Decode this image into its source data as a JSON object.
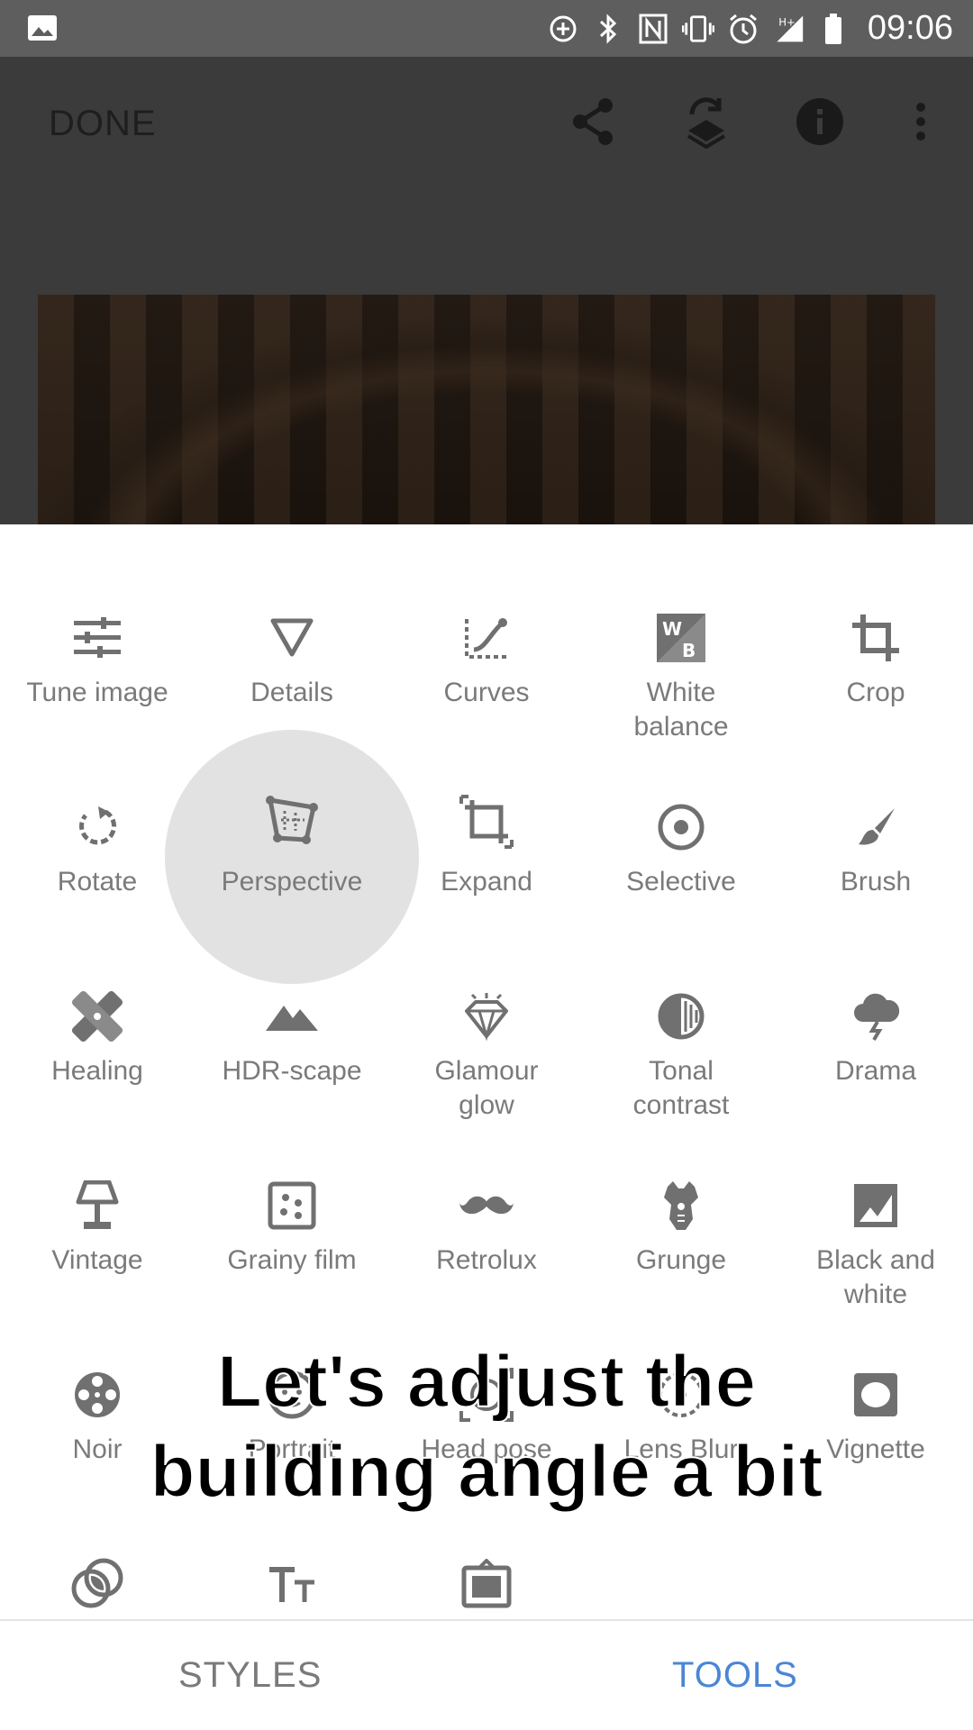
{
  "status_bar": {
    "time": "09:06",
    "icons": [
      "image-icon",
      "data-saver-icon",
      "bluetooth-icon",
      "nfc-icon",
      "vibrate-icon",
      "alarm-icon",
      "signal-hplus-icon",
      "battery-icon"
    ]
  },
  "top_bar": {
    "done_label": "DONE",
    "icons": [
      "share-icon",
      "layers-undo-icon",
      "info-icon",
      "more-vert-icon"
    ]
  },
  "tools": [
    {
      "label": "Tune image",
      "icon": "tune-icon"
    },
    {
      "label": "Details",
      "icon": "details-triangle-icon"
    },
    {
      "label": "Curves",
      "icon": "curves-icon"
    },
    {
      "label": "White\nbalance",
      "icon": "white-balance-icon"
    },
    {
      "label": "Crop",
      "icon": "crop-icon"
    },
    {
      "label": "Rotate",
      "icon": "rotate-icon"
    },
    {
      "label": "Perspective",
      "icon": "perspective-icon"
    },
    {
      "label": "Expand",
      "icon": "expand-icon"
    },
    {
      "label": "Selective",
      "icon": "selective-icon"
    },
    {
      "label": "Brush",
      "icon": "brush-icon"
    },
    {
      "label": "Healing",
      "icon": "healing-icon"
    },
    {
      "label": "HDR-scape",
      "icon": "mountains-icon"
    },
    {
      "label": "Glamour\nglow",
      "icon": "diamond-icon"
    },
    {
      "label": "Tonal\ncontrast",
      "icon": "tonal-contrast-icon"
    },
    {
      "label": "Drama",
      "icon": "storm-cloud-icon"
    },
    {
      "label": "Vintage",
      "icon": "lamp-icon"
    },
    {
      "label": "Grainy film",
      "icon": "grainy-film-icon"
    },
    {
      "label": "Retrolux",
      "icon": "moustache-icon"
    },
    {
      "label": "Grunge",
      "icon": "grunge-guitar-icon"
    },
    {
      "label": "Black and\nwhite",
      "icon": "black-white-icon"
    },
    {
      "label": "Noir",
      "icon": "film-reel-icon"
    },
    {
      "label": "Portrait",
      "icon": "face-icon"
    },
    {
      "label": "Head pose",
      "icon": "head-pose-icon"
    },
    {
      "label": "Lens Blur",
      "icon": "lens-blur-icon"
    },
    {
      "label": "Vignette",
      "icon": "vignette-icon"
    },
    {
      "label": "",
      "icon": "double-exposure-icon"
    },
    {
      "label": "",
      "icon": "text-icon"
    },
    {
      "label": "",
      "icon": "frames-icon"
    }
  ],
  "overlay_caption": "Let's adjust the\nbuilding angle a bit",
  "tabs": {
    "styles": "STYLES",
    "tools": "TOOLS"
  },
  "colors": {
    "active_tab": "#4a86d6",
    "icon_gray": "#707070",
    "label_gray": "#7a7a7a",
    "dim_overlay": "#3b3b3b"
  }
}
